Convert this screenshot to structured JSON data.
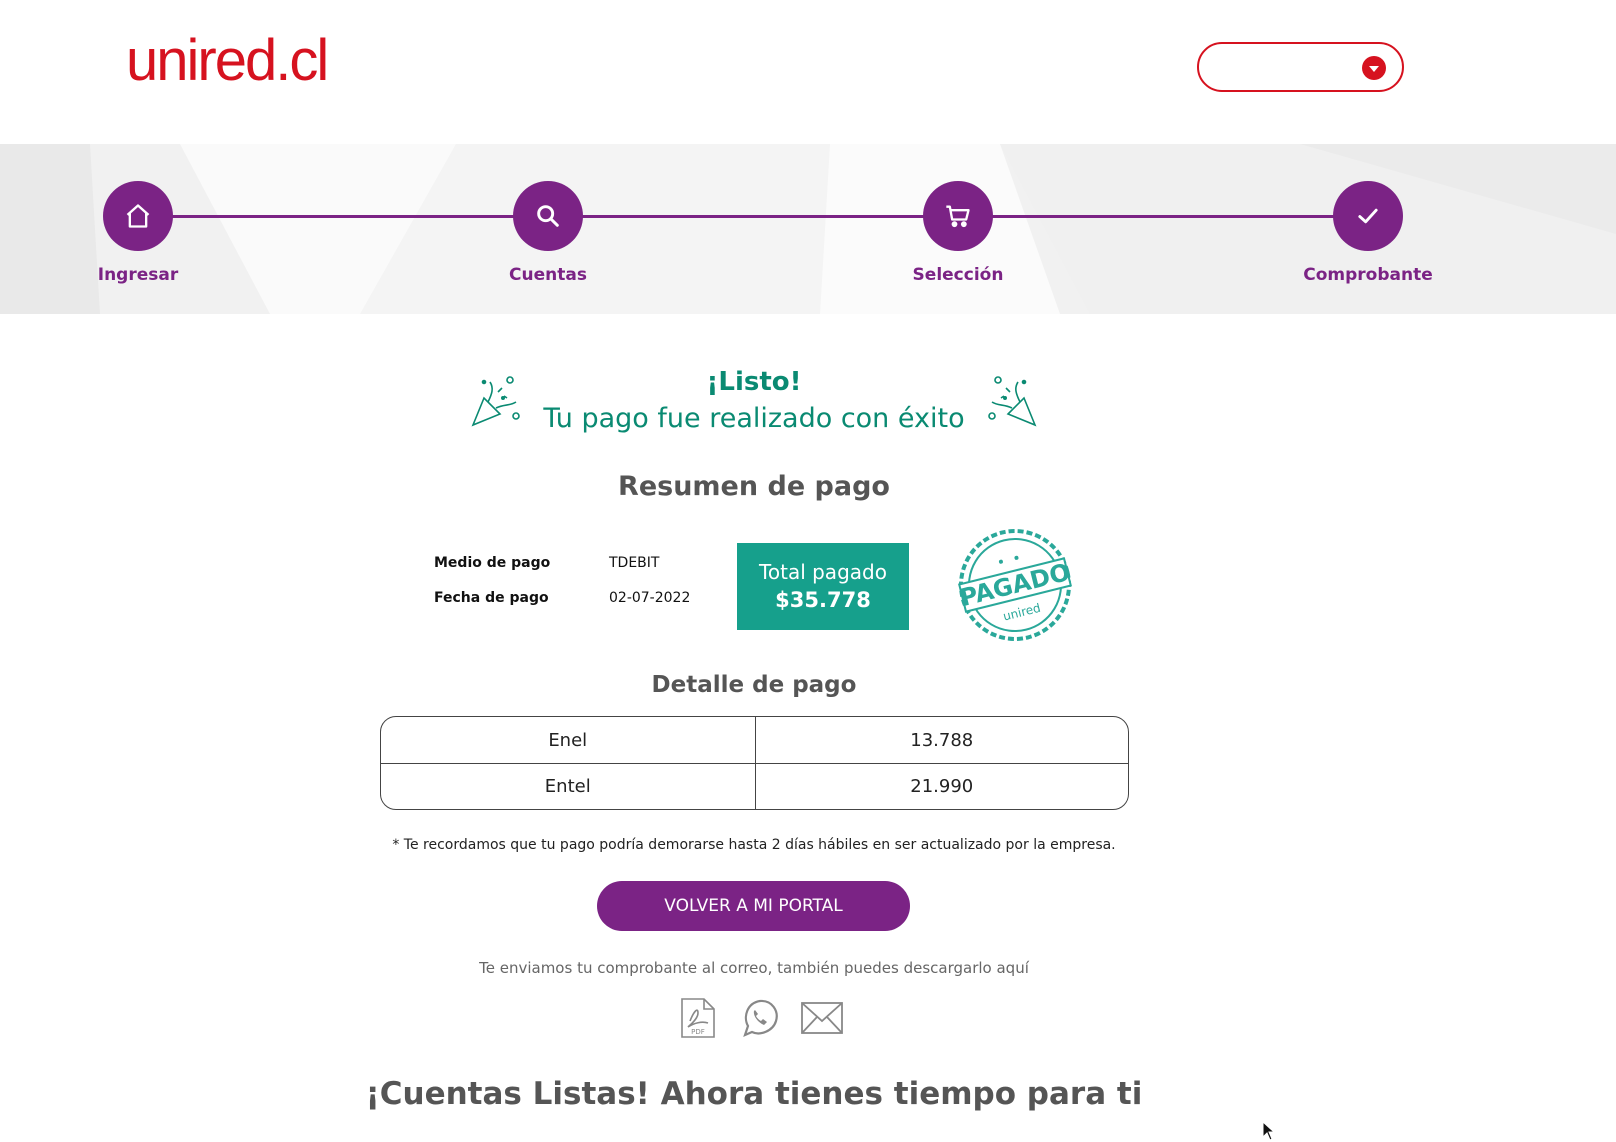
{
  "header": {
    "logo_text": "unired.cl",
    "language_select_value": ""
  },
  "stepper": {
    "steps": [
      {
        "label": "Ingresar",
        "icon": "home-icon"
      },
      {
        "label": "Cuentas",
        "icon": "search-icon"
      },
      {
        "label": "Selección",
        "icon": "cart-icon"
      },
      {
        "label": "Comprobante",
        "icon": "check-icon"
      }
    ],
    "current_step": 4
  },
  "success": {
    "title": "¡Listo!",
    "subtitle": "Tu pago fue realizado con éxito"
  },
  "summary": {
    "heading": "Resumen de pago",
    "payment_method_label": "Medio de pago",
    "payment_method_value": "TDEBIT",
    "payment_date_label": "Fecha de pago",
    "payment_date_value": "02-07-2022",
    "total_label": "Total pagado",
    "total_value": "$35.778",
    "stamp_text": "PAGADO",
    "stamp_brand": "unired"
  },
  "detail": {
    "heading": "Detalle de pago",
    "rows": [
      {
        "company": "Enel",
        "amount": "13.788"
      },
      {
        "company": "Entel",
        "amount": "21.990"
      }
    ]
  },
  "note": "* Te recordamos que tu pago podría demorarse hasta 2 días hábiles en ser actualizado por la empresa.",
  "actions": {
    "portal_button": "VOLVER A MI PORTAL",
    "send_text": "Te enviamos tu comprobante al correo, también puedes descargarlo aquí",
    "share": [
      "pdf-icon",
      "whatsapp-icon",
      "email-icon"
    ]
  },
  "footer": {
    "title": "¡Cuentas Listas! Ahora tienes tiempo para ti"
  },
  "colors": {
    "brand_red": "#d6121f",
    "brand_purple": "#7b2385",
    "success_green": "#0a8a72",
    "total_teal": "#16a08c"
  }
}
